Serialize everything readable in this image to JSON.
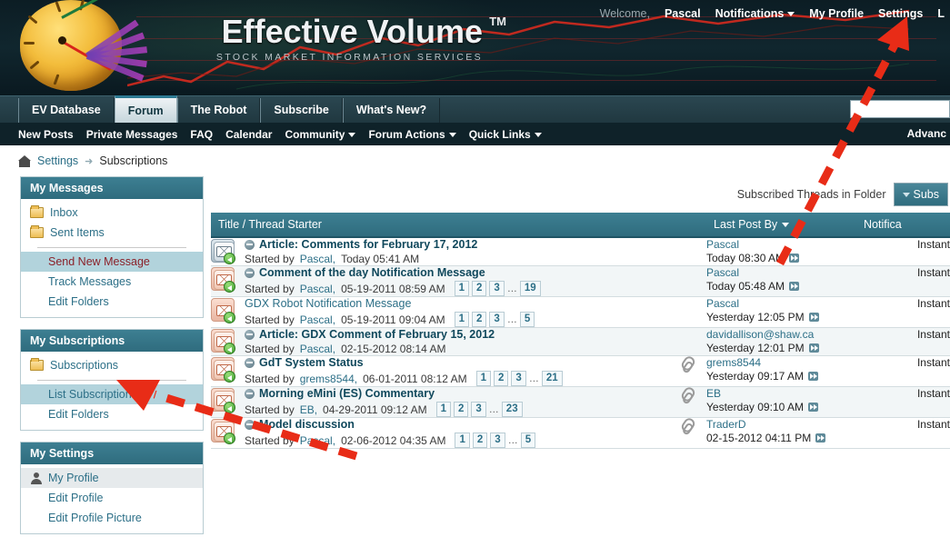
{
  "header": {
    "brand_name": "Effective Volume",
    "brand_tm": "TM",
    "brand_sub": "STOCK MARKET INFORMATION SERVICES",
    "welcome_label": "Welcome,",
    "user_name": "Pascal",
    "notifications_label": "Notifications",
    "my_profile_label": "My Profile",
    "settings_label": "Settings",
    "logout_label": "L",
    "search_value": ""
  },
  "tabs": [
    {
      "label": "EV Database",
      "active": false
    },
    {
      "label": "Forum",
      "active": true
    },
    {
      "label": "The Robot",
      "active": false
    },
    {
      "label": "Subscribe",
      "active": false
    },
    {
      "label": "What's New?",
      "active": false
    }
  ],
  "subnav": {
    "items": [
      {
        "label": "New Posts",
        "caret": false
      },
      {
        "label": "Private Messages",
        "caret": false
      },
      {
        "label": "FAQ",
        "caret": false
      },
      {
        "label": "Calendar",
        "caret": false
      },
      {
        "label": "Community",
        "caret": true
      },
      {
        "label": "Forum Actions",
        "caret": true
      },
      {
        "label": "Quick Links",
        "caret": true
      }
    ],
    "advanced_label": "Advanc"
  },
  "breadcrumb": {
    "home_icon": "home-icon",
    "settings_label": "Settings",
    "separator": "➜",
    "current_label": "Subscriptions"
  },
  "sidebar": {
    "panels": [
      {
        "title": "My Messages",
        "items": [
          {
            "label": "Inbox",
            "icon": "folder-icon",
            "style": "plain"
          },
          {
            "label": "Sent Items",
            "icon": "folder-icon",
            "style": "plain"
          },
          {
            "label": "divider",
            "icon": "",
            "style": "divider"
          },
          {
            "label": "Send New Message",
            "icon": "",
            "style": "highlight-red"
          },
          {
            "label": "Track Messages",
            "icon": "",
            "style": "sub"
          },
          {
            "label": "Edit Folders",
            "icon": "",
            "style": "sub"
          }
        ]
      },
      {
        "title": "My Subscriptions",
        "items": [
          {
            "label": "Subscriptions",
            "icon": "folder-icon",
            "style": "plain"
          },
          {
            "label": "divider",
            "icon": "",
            "style": "divider"
          },
          {
            "label": "List Subscriptions",
            "icon": "",
            "style": "highlight"
          },
          {
            "label": "Edit Folders",
            "icon": "",
            "style": "sub"
          }
        ]
      },
      {
        "title": "My Settings",
        "items": [
          {
            "label": "My Profile",
            "icon": "user-icon",
            "style": "highlight-grey"
          },
          {
            "label": "Edit Profile",
            "icon": "",
            "style": "sub"
          },
          {
            "label": "Edit Profile Picture",
            "icon": "",
            "style": "sub"
          }
        ]
      }
    ]
  },
  "main": {
    "folder_label": "Subscribed Threads in Folder",
    "folder_button_label": "Subs",
    "columns": {
      "title": "Title / Thread Starter",
      "last_post": "Last Post By",
      "notification": "Notifica"
    },
    "rows": [
      {
        "icon": "thread-unread-blue-icon",
        "title": "Article: Comments for February 17, 2012",
        "unread": true,
        "started_by_prefix": "Started by",
        "starter": "Pascal",
        "started_date": "Today 05:41 AM",
        "pages": [],
        "has_attachment": false,
        "last_post_user": "Pascal",
        "last_post_time": "Today 08:30 AM",
        "notification": "Instant"
      },
      {
        "icon": "thread-unread-red-icon",
        "title": "Comment of the day Notification Message",
        "unread": true,
        "started_by_prefix": "Started by",
        "starter": "Pascal",
        "started_date": "05-19-2011 08:59 AM",
        "pages": [
          "1",
          "2",
          "3",
          "...",
          "19"
        ],
        "has_attachment": false,
        "last_post_user": "Pascal",
        "last_post_time": "Today 05:48 AM",
        "notification": "Instant"
      },
      {
        "icon": "thread-read-red-icon",
        "title": "GDX Robot Notification Message",
        "unread": false,
        "started_by_prefix": "Started by",
        "starter": "Pascal",
        "started_date": "05-19-2011 09:04 AM",
        "pages": [
          "1",
          "2",
          "3",
          "...",
          "5"
        ],
        "has_attachment": false,
        "last_post_user": "Pascal",
        "last_post_time": "Yesterday 12:05 PM",
        "notification": "Instant"
      },
      {
        "icon": "thread-unread-red-icon",
        "title": "Article: GDX Comment of February 15, 2012",
        "unread": true,
        "started_by_prefix": "Started by",
        "starter": "Pascal",
        "started_date": "02-15-2012 08:14 AM",
        "pages": [],
        "has_attachment": false,
        "last_post_user": "davidallison@shaw.ca",
        "last_post_time": "Yesterday 12:01 PM",
        "notification": "Instant"
      },
      {
        "icon": "thread-unread-red-icon",
        "title": "GdT System Status",
        "unread": true,
        "started_by_prefix": "Started by",
        "starter": "grems8544",
        "started_date": "06-01-2011 08:12 AM",
        "pages": [
          "1",
          "2",
          "3",
          "...",
          "21"
        ],
        "has_attachment": true,
        "last_post_user": "grems8544",
        "last_post_time": "Yesterday 09:17 AM",
        "notification": "Instant"
      },
      {
        "icon": "thread-unread-red-icon",
        "title": "Morning eMini (ES) Commentary",
        "unread": true,
        "started_by_prefix": "Started by",
        "starter": "EB",
        "started_date": "04-29-2011 09:12 AM",
        "pages": [
          "1",
          "2",
          "3",
          "...",
          "23"
        ],
        "has_attachment": true,
        "last_post_user": "EB",
        "last_post_time": "Yesterday 09:10 AM",
        "notification": "Instant"
      },
      {
        "icon": "thread-unread-red-icon",
        "title": "Model discussion",
        "unread": true,
        "started_by_prefix": "Started by",
        "starter": "Pascal",
        "started_date": "02-06-2012 04:35 AM",
        "pages": [
          "1",
          "2",
          "3",
          "...",
          "5"
        ],
        "has_attachment": true,
        "last_post_user": "TraderD",
        "last_post_time": "02-15-2012 04:11 PM",
        "notification": "Instant"
      }
    ]
  },
  "annotations": {
    "arrow_color": "#e82c17",
    "arrow_settings_target": "Settings",
    "arrow_subscriptions_target": "Subscriptions"
  }
}
